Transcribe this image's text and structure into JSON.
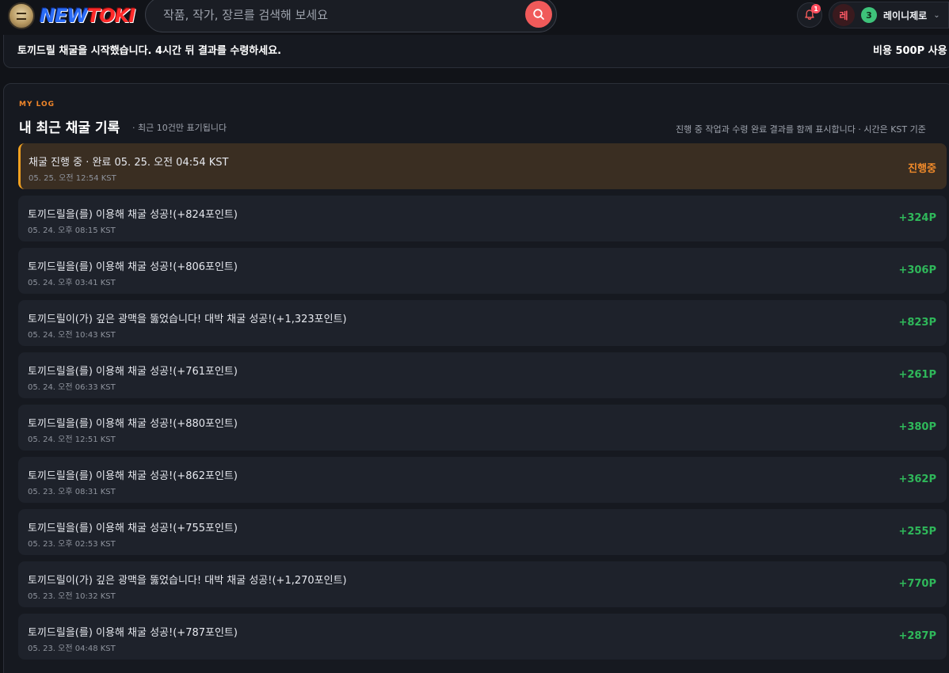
{
  "header": {
    "logo_new": "NEW",
    "logo_toki": "TOKI",
    "search_placeholder": "작품, 작가, 장르를 검색해 보세요",
    "notification_count": "1",
    "user_avatar": "레",
    "user_level": "3",
    "user_name": "레이니제로"
  },
  "notice": {
    "message": "토끼드릴 채굴을 시작했습니다. 4시간 뒤 결과를 수령하세요.",
    "cost": "비용 500P 사용"
  },
  "log": {
    "eyebrow": "MY LOG",
    "title": "내 최근 채굴 기록",
    "subtitle": "· 최근 10건만 표기됩니다",
    "right_note": "진행 중 작업과 수령 완료 결과를 함께 표시합니다 · 시간은 KST 기준",
    "rows": [
      {
        "text": "채굴 진행 중 · 완료 05. 25. 오전 04:54 KST",
        "time": "05. 25. 오전 12:54 KST",
        "value": "진행중",
        "active": true
      },
      {
        "text": "토끼드릴을(를) 이용해 채굴 성공!(+824포인트)",
        "time": "05. 24. 오후 08:15 KST",
        "value": "+324P"
      },
      {
        "text": "토끼드릴을(를) 이용해 채굴 성공!(+806포인트)",
        "time": "05. 24. 오후 03:41 KST",
        "value": "+306P"
      },
      {
        "text": "토끼드릴이(가) 깊은 광맥을 뚫었습니다! 대박 채굴 성공!(+1,323포인트)",
        "time": "05. 24. 오전 10:43 KST",
        "value": "+823P"
      },
      {
        "text": "토끼드릴을(를) 이용해 채굴 성공!(+761포인트)",
        "time": "05. 24. 오전 06:33 KST",
        "value": "+261P"
      },
      {
        "text": "토끼드릴을(를) 이용해 채굴 성공!(+880포인트)",
        "time": "05. 24. 오전 12:51 KST",
        "value": "+380P"
      },
      {
        "text": "토끼드릴을(를) 이용해 채굴 성공!(+862포인트)",
        "time": "05. 23. 오후 08:31 KST",
        "value": "+362P"
      },
      {
        "text": "토끼드릴을(를) 이용해 채굴 성공!(+755포인트)",
        "time": "05. 23. 오후 02:53 KST",
        "value": "+255P"
      },
      {
        "text": "토끼드릴이(가) 깊은 광맥을 뚫었습니다! 대박 채굴 성공!(+1,270포인트)",
        "time": "05. 23. 오전 10:32 KST",
        "value": "+770P"
      },
      {
        "text": "토끼드릴을(를) 이용해 채굴 성공!(+787포인트)",
        "time": "05. 23. 오전 04:48 KST",
        "value": "+287P"
      }
    ]
  },
  "colors": {
    "accent_orange": "#f0862a",
    "success_green": "#2fb85a",
    "search_button": "#f05a5a"
  },
  "icons": {
    "search": "search-icon",
    "bell": "bell-icon",
    "chevron": "chevron-down-icon"
  }
}
